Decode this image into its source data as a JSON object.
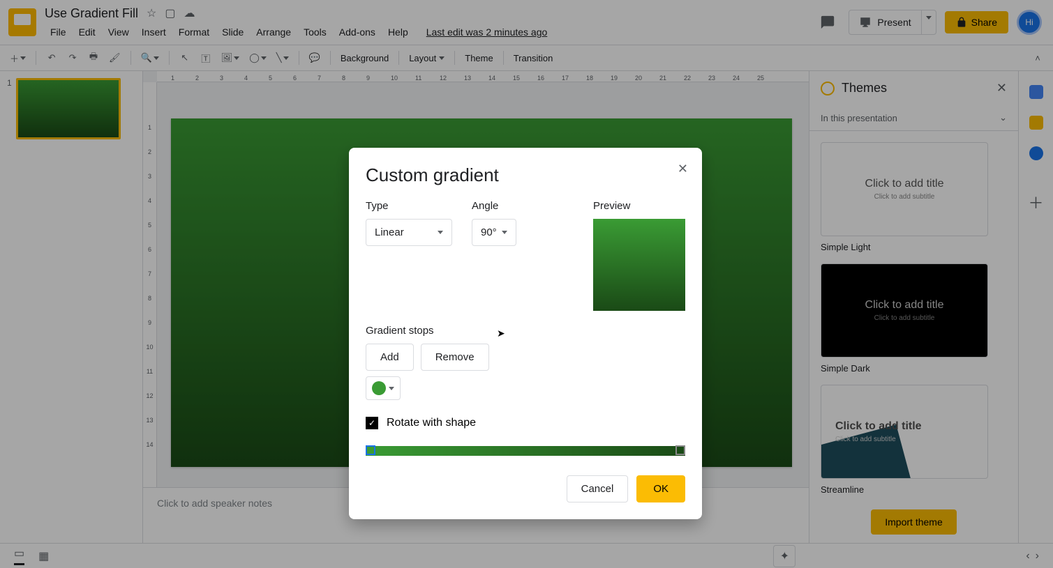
{
  "doc": {
    "title": "Use Gradient Fill",
    "last_edit": "Last edit was 2 minutes ago",
    "avatar": "Hi"
  },
  "menubar": {
    "file": "File",
    "edit": "Edit",
    "view": "View",
    "insert": "Insert",
    "format": "Format",
    "slide": "Slide",
    "arrange": "Arrange",
    "tools": "Tools",
    "addons": "Add-ons",
    "help": "Help"
  },
  "header_actions": {
    "present": "Present",
    "share": "Share"
  },
  "toolbar": {
    "background": "Background",
    "layout": "Layout",
    "theme": "Theme",
    "transition": "Transition"
  },
  "filmstrip": {
    "slides": [
      {
        "num": "1"
      }
    ]
  },
  "sidepanel": {
    "title": "Themes",
    "subtitle": "In this presentation",
    "themes": [
      {
        "name": "Simple Light",
        "title": "Click to add title",
        "sub": "Click to add subtitle",
        "variant": "light"
      },
      {
        "name": "Simple Dark",
        "title": "Click to add title",
        "sub": "Click to add subtitle",
        "variant": "dark"
      },
      {
        "name": "Streamline",
        "title": "Click to add title",
        "sub": "Click to add subtitle",
        "variant": "stream"
      }
    ],
    "import": "Import theme"
  },
  "speaker_notes": {
    "placeholder": "Click to add speaker notes"
  },
  "dialog": {
    "title": "Custom gradient",
    "type_label": "Type",
    "type_value": "Linear",
    "angle_label": "Angle",
    "angle_value": "90°",
    "preview_label": "Preview",
    "stops_label": "Gradient stops",
    "add": "Add",
    "remove": "Remove",
    "rotate": "Rotate with shape",
    "cancel": "Cancel",
    "ok": "OK"
  }
}
